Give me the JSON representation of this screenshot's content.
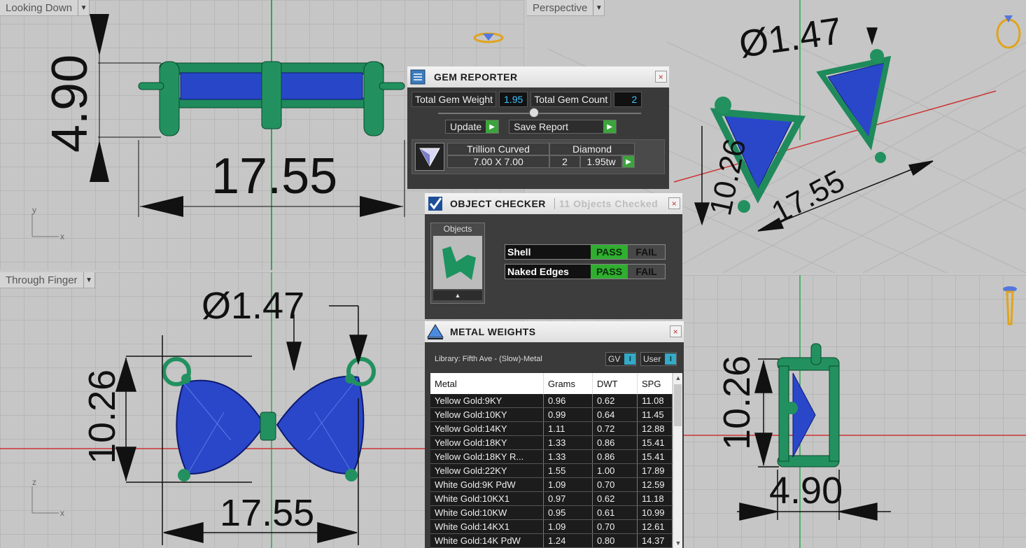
{
  "viewports": {
    "top_left": {
      "label": "Looking Down",
      "dims": [
        "4.90",
        "17.55"
      ],
      "axes": [
        "y",
        "x"
      ]
    },
    "top_right": {
      "label": "Perspective",
      "dims": [
        "Ø1.47",
        "10.26",
        "17.55"
      ]
    },
    "bottom_left": {
      "label": "Through Finger",
      "dims": [
        "Ø1.47",
        "10.26",
        "17.55"
      ],
      "axes": [
        "z",
        "x"
      ]
    },
    "bottom_right": {
      "dims": [
        "10.26",
        "4.90"
      ]
    }
  },
  "gem_reporter": {
    "title": "GEM REPORTER",
    "close": "×",
    "total_weight_label": "Total Gem Weight",
    "total_weight": "1.95",
    "total_count_label": "Total Gem Count",
    "total_count": "2",
    "update": "Update",
    "save_report": "Save Report",
    "gem": {
      "cut": "Trillion Curved",
      "type": "Diamond",
      "size": "7.00 X 7.00",
      "count": "2",
      "weight": "1.95tw"
    }
  },
  "object_checker": {
    "title": "OBJECT CHECKER",
    "status": "11 Objects Checked",
    "close": "×",
    "objects_label": "Objects",
    "checks": [
      {
        "name": "Shell",
        "pass": "PASS",
        "fail": "FAIL"
      },
      {
        "name": "Naked Edges",
        "pass": "PASS",
        "fail": "FAIL"
      }
    ]
  },
  "metal_weights": {
    "title": "METAL WEIGHTS",
    "close": "×",
    "library": "Library: Fifth Ave - (Slow)-Metal",
    "toggle_gv": "GV",
    "toggle_user": "User",
    "columns": [
      "Metal",
      "Grams",
      "DWT",
      "SPG"
    ],
    "rows": [
      [
        "Yellow Gold:9KY",
        "0.96",
        "0.62",
        "11.08"
      ],
      [
        "Yellow Gold:10KY",
        "0.99",
        "0.64",
        "11.45"
      ],
      [
        "Yellow Gold:14KY",
        "1.11",
        "0.72",
        "12.88"
      ],
      [
        "Yellow Gold:18KY",
        "1.33",
        "0.86",
        "15.41"
      ],
      [
        "Yellow Gold:18KY R...",
        "1.33",
        "0.86",
        "15.41"
      ],
      [
        "Yellow Gold:22KY",
        "1.55",
        "1.00",
        "17.89"
      ],
      [
        "White Gold:9K PdW",
        "1.09",
        "0.70",
        "12.59"
      ],
      [
        "White Gold:10KX1",
        "0.97",
        "0.62",
        "11.18"
      ],
      [
        "White Gold:10KW",
        "0.95",
        "0.61",
        "10.99"
      ],
      [
        "White Gold:14KX1",
        "1.09",
        "0.70",
        "12.61"
      ],
      [
        "White Gold:14K PdW",
        "1.24",
        "0.80",
        "14.37"
      ]
    ]
  }
}
